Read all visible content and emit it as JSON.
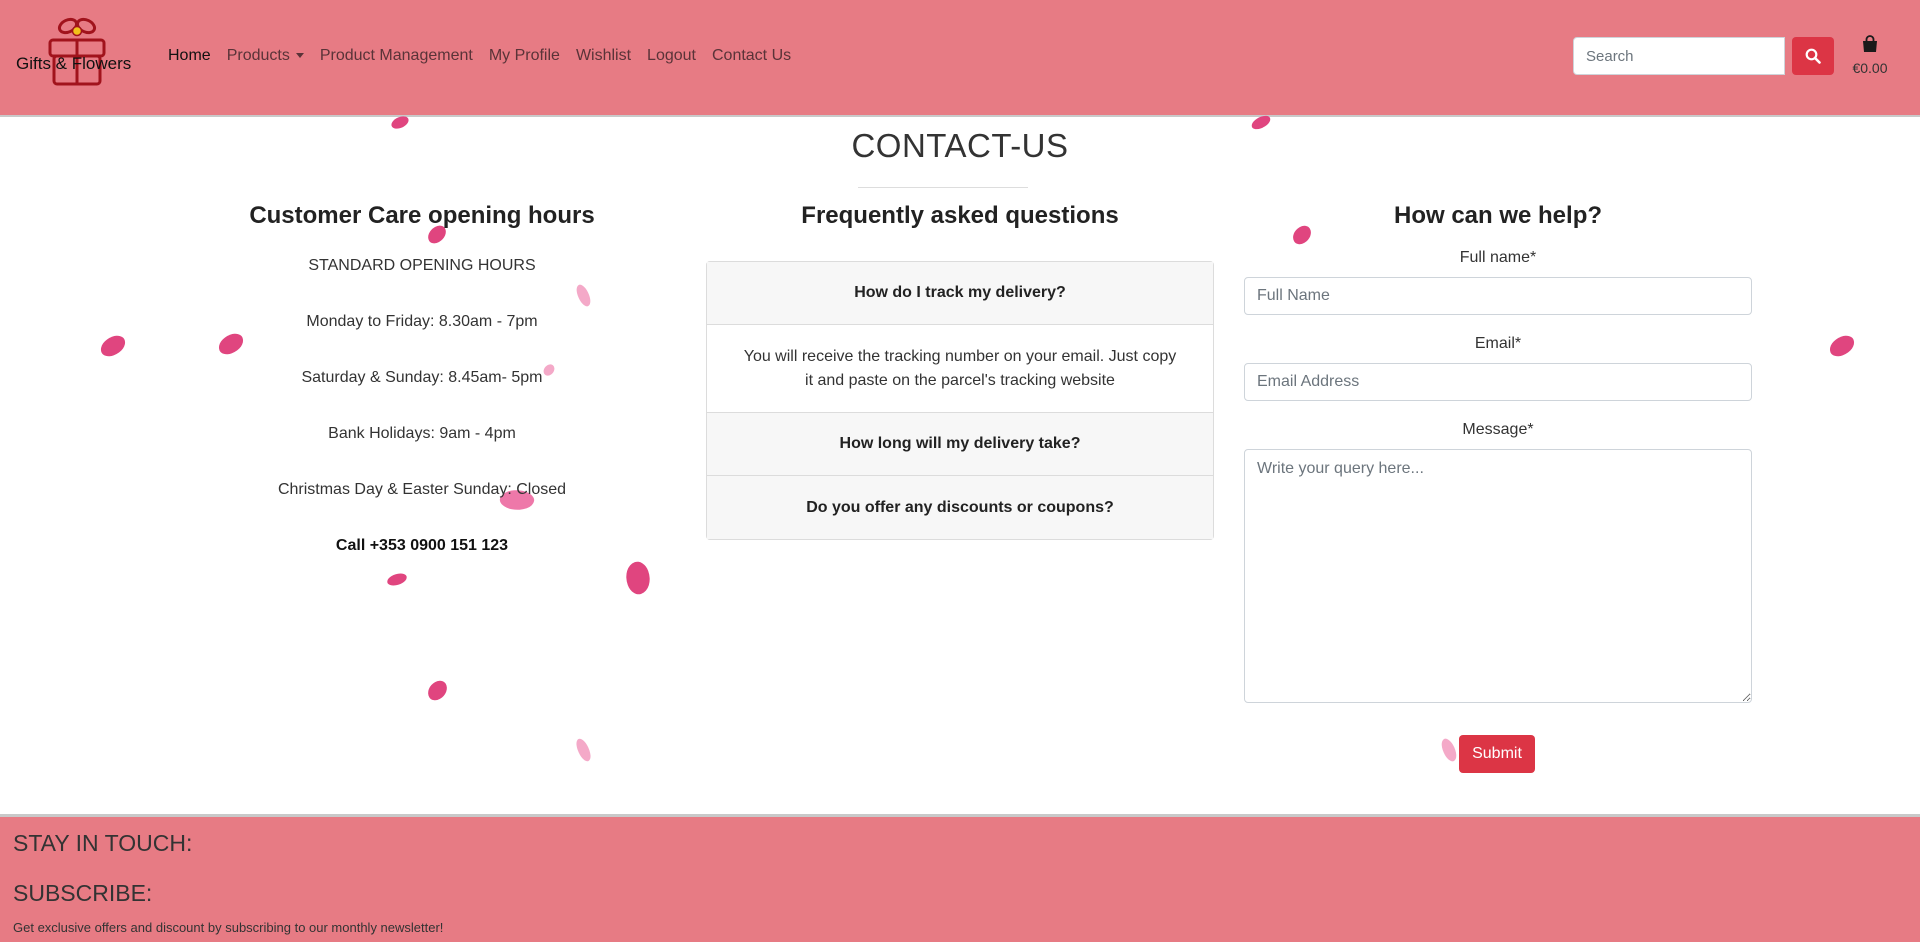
{
  "brand": {
    "name": "Gifts & Flowers"
  },
  "nav": {
    "home": "Home",
    "products": "Products",
    "product_management": "Product Management",
    "my_profile": "My Profile",
    "wishlist": "Wishlist",
    "logout": "Logout",
    "contact_us": "Contact Us"
  },
  "search": {
    "placeholder": "Search",
    "icon": "search-icon"
  },
  "cart": {
    "icon": "shopping-bag-icon",
    "total": "€0.00"
  },
  "page": {
    "title": "CONTACT-US"
  },
  "opening_hours": {
    "heading": "Customer Care opening hours",
    "lines": [
      "STANDARD OPENING HOURS",
      "Monday to Friday: 8.30am - 7pm",
      "Saturday & Sunday: 8.45am- 5pm",
      "Bank Holidays: 9am - 4pm",
      "Christmas Day & Easter Sunday: Closed"
    ],
    "phone": "Call +353 0900 151 123"
  },
  "faq": {
    "heading": "Frequently asked questions",
    "items": [
      {
        "question": "How do I track my delivery?",
        "answer": "You will receive the tracking number on your email. Just copy it and paste on the parcel's tracking website"
      },
      {
        "question": "How long will my delivery take?"
      },
      {
        "question": "Do you offer any discounts or coupons?"
      }
    ]
  },
  "contact_form": {
    "heading": "How can we help?",
    "full_name_label": "Full name*",
    "full_name_placeholder": "Full Name",
    "email_label": "Email*",
    "email_placeholder": "Email Address",
    "message_label": "Message*",
    "message_placeholder": "Write your query here...",
    "submit_label": "Submit"
  },
  "footer": {
    "stay_in_touch": "STAY IN TOUCH:",
    "subscribe": "SUBSCRIBE:",
    "subscribe_text": "Get exclusive offers and discount by subscribing to our monthly newsletter!"
  },
  "colors": {
    "navbar_bg": "#e77b84",
    "accent_red": "#dc3545",
    "petal_dark": "#e0457f",
    "petal_light": "#f4a9c8"
  }
}
